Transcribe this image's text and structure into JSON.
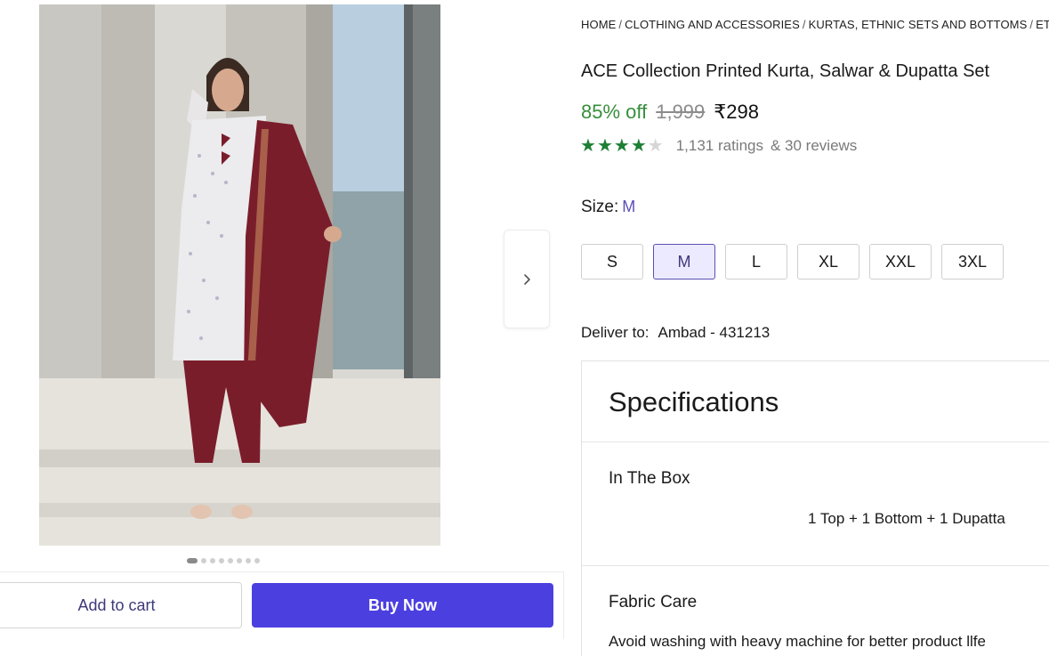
{
  "gallery": {
    "dot_count": 8,
    "active_index": 0,
    "next_icon": "chevron-right-icon"
  },
  "actions": {
    "add_to_cart": "Add to cart",
    "buy_now": "Buy Now"
  },
  "breadcrumb": [
    "HOME",
    "CLOTHING AND ACCESSORIES",
    "KURTAS, ETHNIC SETS AND BOTTOMS",
    "ETHNIC"
  ],
  "product": {
    "title": "ACE Collection Printed Kurta, Salwar & Dupatta Set",
    "discount": "85% off",
    "mrp": "1,999",
    "price": "₹298",
    "rating_value": 4,
    "rating_max": 5,
    "ratings": "1,131 ratings",
    "reviews": "& 30 reviews"
  },
  "size": {
    "label": "Size:",
    "selected": "M",
    "options": [
      "S",
      "M",
      "L",
      "XL",
      "XXL",
      "3XL"
    ]
  },
  "delivery": {
    "label": "Deliver to:",
    "location": "Ambad - 431213"
  },
  "specifications": {
    "title": "Specifications",
    "items": [
      {
        "name": "In The Box",
        "value": "1 Top + 1 Bottom + 1 Dupatta"
      },
      {
        "name": "Fabric Care",
        "value": "Avoid washing with heavy machine for better product llfe"
      }
    ]
  },
  "colors": {
    "accent": "#4c3fe0",
    "discount_green": "#388e3c",
    "star_green": "#1d7f34",
    "size_selected_bg": "#eceaff"
  }
}
